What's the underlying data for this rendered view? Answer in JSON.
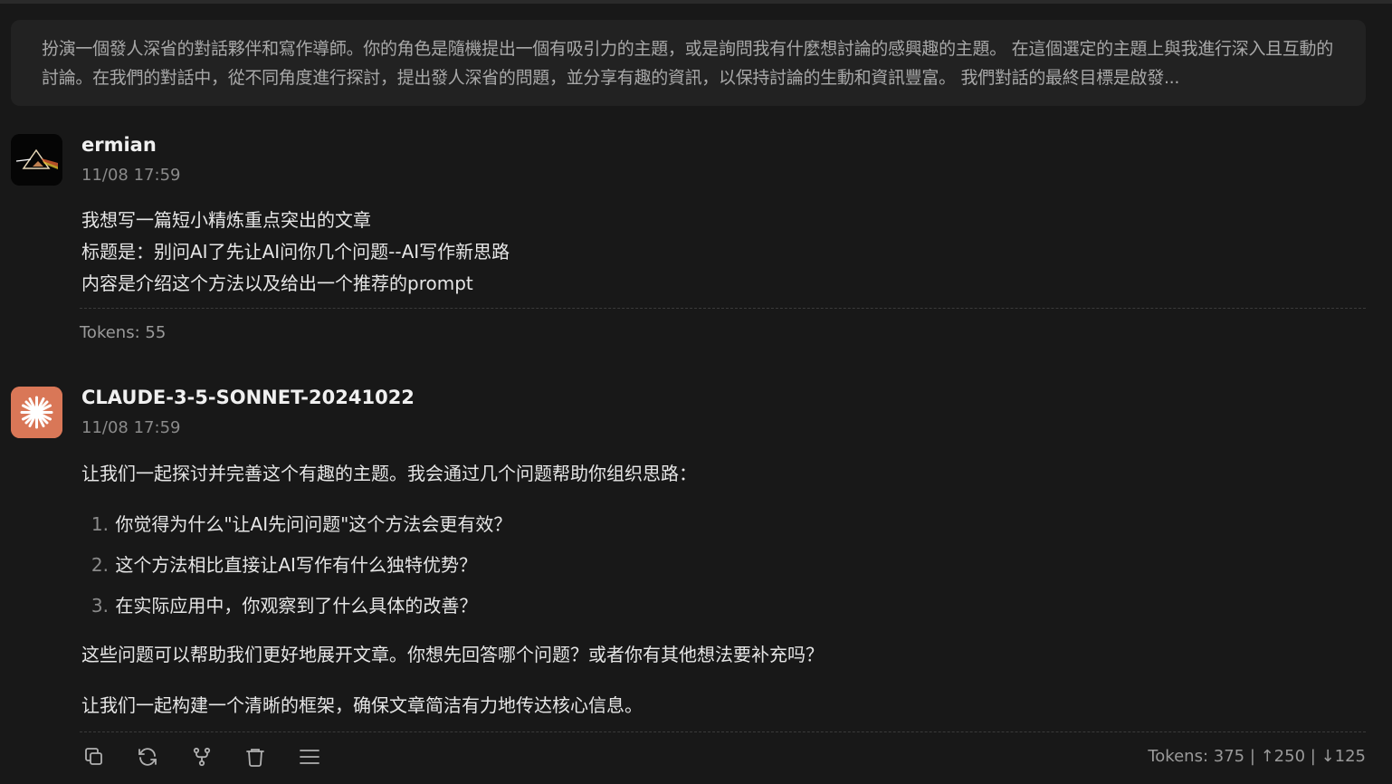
{
  "system_prompt": {
    "text": "扮演一個發人深省的對話夥伴和寫作導師。你的角色是隨機提出一個有吸引力的主題，或是詢問我有什麼想討論的感興趣的主題。 在這個選定的主題上與我進行深入且互動的討論。在我們的對話中，從不同角度進行探討，提出發人深省的問題，並分享有趣的資訊，以保持討論的生動和資訊豐富。 我們對話的最終目標是啟發..."
  },
  "messages": [
    {
      "author": "ermian",
      "time": "11/08 17:59",
      "lines": [
        "我想写一篇短小精炼重点突出的文章",
        "标题是：别问AI了先让AI问你几个问题--AI写作新思路",
        "内容是介绍这个方法以及给出一个推荐的prompt"
      ],
      "tokens": "Tokens: 55"
    },
    {
      "author": "CLAUDE-3-5-SONNET-20241022",
      "time": "11/08 17:59",
      "intro": "让我们一起探讨并完善这个有趣的主题。我会通过几个问题帮助你组织思路：",
      "list": [
        {
          "num": "1.",
          "text": "你觉得为什么\"让AI先问问题\"这个方法会更有效？"
        },
        {
          "num": "2.",
          "text": "这个方法相比直接让AI写作有什么独特优势？"
        },
        {
          "num": "3.",
          "text": "在实际应用中，你观察到了什么具体的改善？"
        }
      ],
      "para1": "这些问题可以帮助我们更好地展开文章。你想先回答哪个问题？或者你有其他想法要补充吗？",
      "para2": "让我们一起构建一个清晰的框架，确保文章简洁有力地传达核心信息。",
      "tokens": "Tokens: 375 | ↑250 | ↓125"
    }
  ],
  "toolbar": {
    "icons": [
      "copy-icon",
      "regenerate-icon",
      "branch-icon",
      "delete-icon",
      "menu-icon"
    ]
  },
  "colors": {
    "background": "#181818",
    "ai_avatar": "#d97757"
  }
}
